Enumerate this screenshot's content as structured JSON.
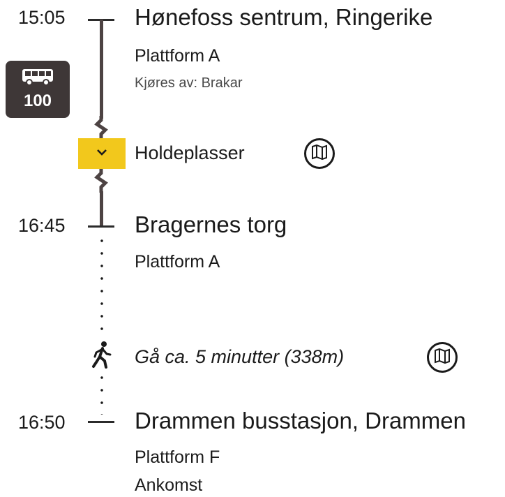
{
  "legs": [
    {
      "time": "15:05",
      "stop": "Hønefoss sentrum, Ringerike",
      "platform": "Plattform A",
      "operator": "Kjøres av: Brakar"
    },
    {
      "time": "16:45",
      "stop": "Bragernes torg",
      "platform": "Plattform A"
    },
    {
      "time": "16:50",
      "stop": "Drammen busstasjon, Drammen",
      "platform": "Plattform F",
      "status": "Ankomst"
    }
  ],
  "bus": {
    "line": "100",
    "icon": "bus-icon"
  },
  "stops_toggle": {
    "label": "Holdeplasser",
    "icon": "chevron-down-icon"
  },
  "walk": {
    "text": "Gå ca. 5 minutter (338m)",
    "icon": "walking-person-icon"
  },
  "map_icon": "map-icon",
  "colors": {
    "accent": "#f2c81c",
    "line": "#4d4343",
    "badge": "#3e3737"
  }
}
